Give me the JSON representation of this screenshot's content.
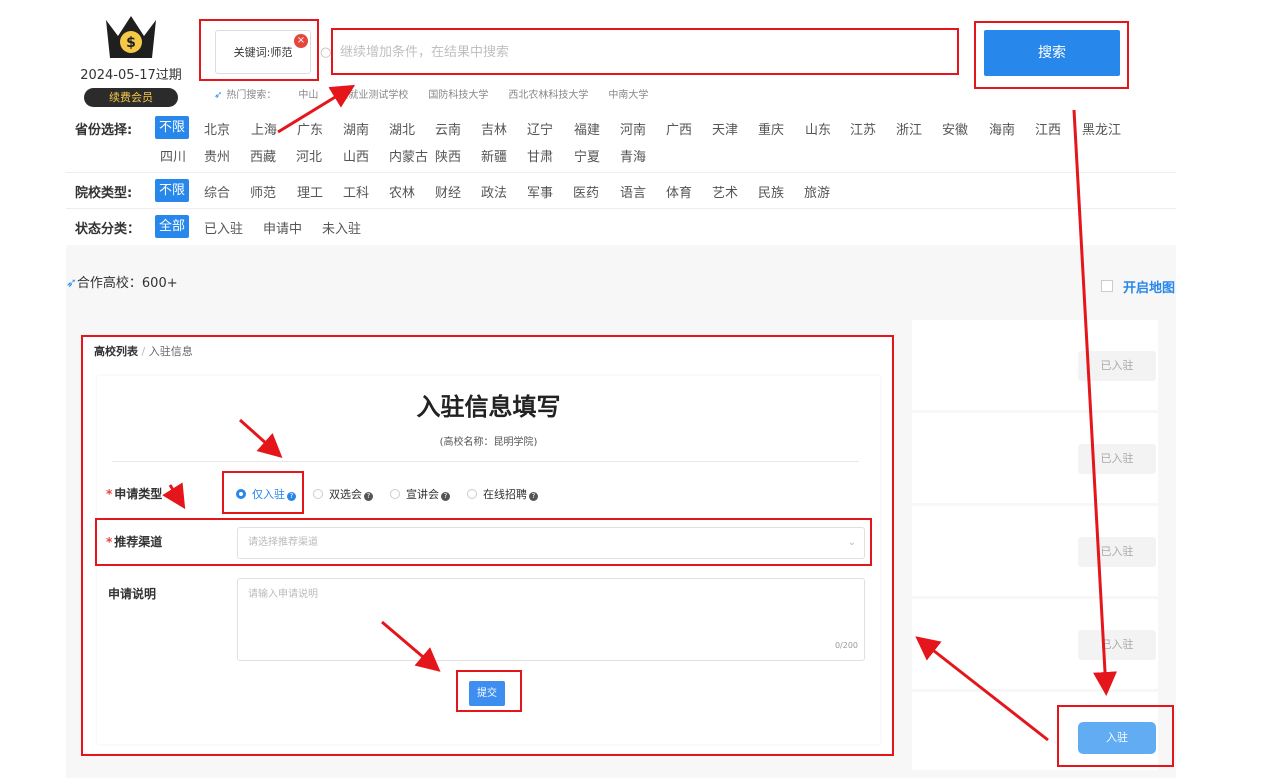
{
  "brand": {
    "expire_text": "2024-05-17过期",
    "member_label": "续费会员",
    "crown_icon": "crown-dollar-icon"
  },
  "search": {
    "tag_label": "关键词:师范",
    "placeholder": "继续增加条件，在结果中搜索",
    "button_label": "搜索",
    "hot_label": "热门搜索：",
    "hot_items": [
      "中山",
      "云就业测试学校",
      "国防科技大学",
      "西北农林科技大学",
      "中南大学"
    ]
  },
  "filters": {
    "province_label": "省份选择:",
    "provinces": [
      "不限",
      "北京",
      "上海",
      "广东",
      "湖南",
      "湖北",
      "云南",
      "吉林",
      "辽宁",
      "福建",
      "河南",
      "广西",
      "天津",
      "重庆",
      "山东",
      "江苏",
      "浙江",
      "安徽",
      "海南",
      "江西",
      "黑龙江",
      "四川",
      "贵州",
      "西藏",
      "河北",
      "山西",
      "内蒙古",
      "陕西",
      "新疆",
      "甘肃",
      "宁夏",
      "青海"
    ],
    "type_label": "院校类型:",
    "types": [
      "不限",
      "综合",
      "师范",
      "理工",
      "工科",
      "农林",
      "财经",
      "政法",
      "军事",
      "医药",
      "语言",
      "体育",
      "艺术",
      "民族",
      "旅游"
    ],
    "status_label": "状态分类：",
    "statuses": [
      "全部",
      "已入驻",
      "申请中",
      "未入驻"
    ]
  },
  "partners": {
    "label": "合作高校：600+",
    "map_label": "开启地图"
  },
  "list": {
    "joined_label": "已入驻",
    "enter_label": "入驻"
  },
  "form": {
    "breadcrumb_root": "高校列表",
    "breadcrumb_sep": "/",
    "breadcrumb_current": "入驻信息",
    "title": "入驻信息填写",
    "subtitle": "(高校名称：昆明学院)",
    "type_label": "申请类型",
    "type_options": [
      "仅入驻",
      "双选会",
      "宣讲会",
      "在线招聘"
    ],
    "type_selected": "仅入驻",
    "channel_label": "推荐渠道",
    "channel_placeholder": "请选择推荐渠道",
    "desc_label": "申请说明",
    "desc_placeholder": "请输入申请说明",
    "desc_counter": "0/200",
    "submit_label": "提交"
  },
  "colors": {
    "accent": "#2787ea",
    "highlight": "#e4161c",
    "member_gold": "#f5c948"
  }
}
